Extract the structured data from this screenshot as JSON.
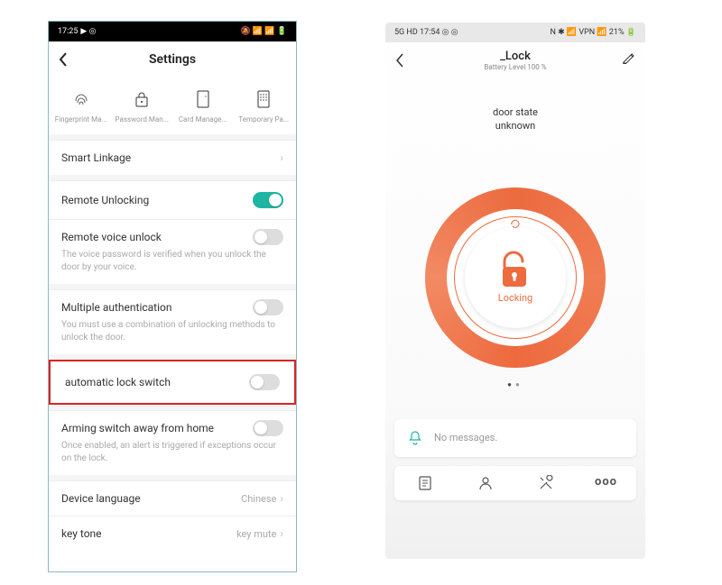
{
  "left": {
    "statusbar": {
      "time": "17:25",
      "icons": "▶ ◎",
      "right": "🔕 📶 📶 🔋"
    },
    "header": {
      "title": "Settings"
    },
    "managers": [
      {
        "label": "Fingerprint Ma..."
      },
      {
        "label": "Password Man..."
      },
      {
        "label": "Card Manage..."
      },
      {
        "label": "Temporary Pa..."
      }
    ],
    "rows": {
      "smart_linkage": "Smart Linkage",
      "remote_unlocking": "Remote Unlocking",
      "remote_voice": {
        "title": "Remote voice unlock",
        "desc": "The voice password is verified when you unlock the door by your voice."
      },
      "multi_auth": {
        "title": "Multiple authentication",
        "desc": "You must use a combination of unlocking methods to unlock the door."
      },
      "auto_lock": {
        "title": "automatic lock switch"
      },
      "arming": {
        "title": "Arming switch away from home",
        "desc": "Once enabled, an alert is triggered if exceptions occur on the lock."
      },
      "device_lang": {
        "title": "Device language",
        "value": "Chinese"
      },
      "key_tone": {
        "title": "key tone",
        "value": "key mute"
      }
    }
  },
  "right": {
    "statusbar": {
      "left": "5G HD 17:54 ◎ ◎",
      "right": "N ✱ 📶 VPN 📶 21% 🔋"
    },
    "device": {
      "name": "_Lock",
      "battery": "Battery Level 100 %"
    },
    "door_state": {
      "l1": "door state",
      "l2": "unknown"
    },
    "action": "Locking",
    "msg": "No messages.",
    "nav": {
      "more": "ooo"
    }
  }
}
